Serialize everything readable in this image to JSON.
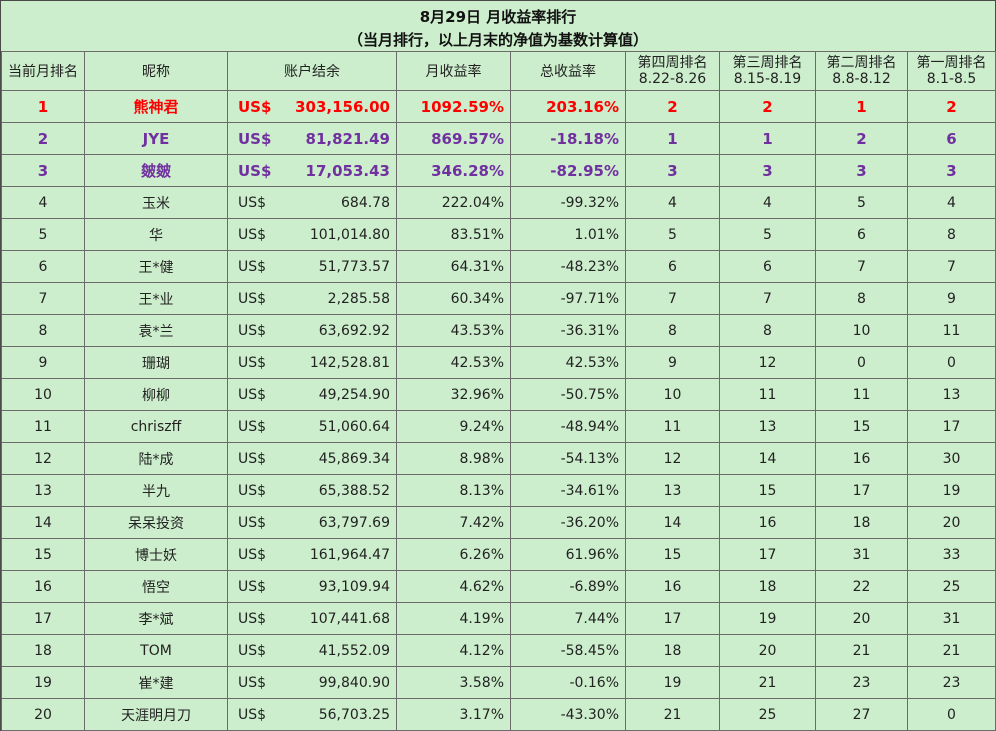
{
  "title": "8月29日 月收益率排行",
  "subtitle": "（当月排行，以上月末的净值为基数计算值）",
  "headers": {
    "rank": "当前月排名",
    "nickname": "昵称",
    "balance": "账户结余",
    "monthly_return": "月收益率",
    "total_return": "总收益率",
    "week4": {
      "label": "第四周排名",
      "range": "8.22-8.26"
    },
    "week3": {
      "label": "第三周排名",
      "range": "8.15-8.19"
    },
    "week2": {
      "label": "第二周排名",
      "range": "8.8-8.12"
    },
    "week1": {
      "label": "第一周排名",
      "range": "8.1-8.5"
    }
  },
  "rows": [
    {
      "rank": "1",
      "name": "熊神君",
      "currency": "US$",
      "balance": "303,156.00",
      "monthly": "1092.59%",
      "total": "203.16%",
      "w4": "2",
      "w3": "2",
      "w2": "1",
      "w1": "2"
    },
    {
      "rank": "2",
      "name": "JYE",
      "currency": "US$",
      "balance": "81,821.49",
      "monthly": "869.57%",
      "total": "-18.18%",
      "w4": "1",
      "w3": "1",
      "w2": "2",
      "w1": "6"
    },
    {
      "rank": "3",
      "name": "皴皴",
      "currency": "US$",
      "balance": "17,053.43",
      "monthly": "346.28%",
      "total": "-82.95%",
      "w4": "3",
      "w3": "3",
      "w2": "3",
      "w1": "3"
    },
    {
      "rank": "4",
      "name": "玉米",
      "currency": "US$",
      "balance": "684.78",
      "monthly": "222.04%",
      "total": "-99.32%",
      "w4": "4",
      "w3": "4",
      "w2": "5",
      "w1": "4"
    },
    {
      "rank": "5",
      "name": "华",
      "currency": "US$",
      "balance": "101,014.80",
      "monthly": "83.51%",
      "total": "1.01%",
      "w4": "5",
      "w3": "5",
      "w2": "6",
      "w1": "8"
    },
    {
      "rank": "6",
      "name": "王*健",
      "currency": "US$",
      "balance": "51,773.57",
      "monthly": "64.31%",
      "total": "-48.23%",
      "w4": "6",
      "w3": "6",
      "w2": "7",
      "w1": "7"
    },
    {
      "rank": "7",
      "name": "王*业",
      "currency": "US$",
      "balance": "2,285.58",
      "monthly": "60.34%",
      "total": "-97.71%",
      "w4": "7",
      "w3": "7",
      "w2": "8",
      "w1": "9"
    },
    {
      "rank": "8",
      "name": "袁*兰",
      "currency": "US$",
      "balance": "63,692.92",
      "monthly": "43.53%",
      "total": "-36.31%",
      "w4": "8",
      "w3": "8",
      "w2": "10",
      "w1": "11"
    },
    {
      "rank": "9",
      "name": "珊瑚",
      "currency": "US$",
      "balance": "142,528.81",
      "monthly": "42.53%",
      "total": "42.53%",
      "w4": "9",
      "w3": "12",
      "w2": "0",
      "w1": "0"
    },
    {
      "rank": "10",
      "name": "柳柳",
      "currency": "US$",
      "balance": "49,254.90",
      "monthly": "32.96%",
      "total": "-50.75%",
      "w4": "10",
      "w3": "11",
      "w2": "11",
      "w1": "13"
    },
    {
      "rank": "11",
      "name": "chriszff",
      "currency": "US$",
      "balance": "51,060.64",
      "monthly": "9.24%",
      "total": "-48.94%",
      "w4": "11",
      "w3": "13",
      "w2": "15",
      "w1": "17"
    },
    {
      "rank": "12",
      "name": "陆*成",
      "currency": "US$",
      "balance": "45,869.34",
      "monthly": "8.98%",
      "total": "-54.13%",
      "w4": "12",
      "w3": "14",
      "w2": "16",
      "w1": "30"
    },
    {
      "rank": "13",
      "name": "半九",
      "currency": "US$",
      "balance": "65,388.52",
      "monthly": "8.13%",
      "total": "-34.61%",
      "w4": "13",
      "w3": "15",
      "w2": "17",
      "w1": "19"
    },
    {
      "rank": "14",
      "name": "呆呆投资",
      "currency": "US$",
      "balance": "63,797.69",
      "monthly": "7.42%",
      "total": "-36.20%",
      "w4": "14",
      "w3": "16",
      "w2": "18",
      "w1": "20"
    },
    {
      "rank": "15",
      "name": "博士妖",
      "currency": "US$",
      "balance": "161,964.47",
      "monthly": "6.26%",
      "total": "61.96%",
      "w4": "15",
      "w3": "17",
      "w2": "31",
      "w1": "33"
    },
    {
      "rank": "16",
      "name": "悟空",
      "currency": "US$",
      "balance": "93,109.94",
      "monthly": "4.62%",
      "total": "-6.89%",
      "w4": "16",
      "w3": "18",
      "w2": "22",
      "w1": "25"
    },
    {
      "rank": "17",
      "name": "李*斌",
      "currency": "US$",
      "balance": "107,441.68",
      "monthly": "4.19%",
      "total": "7.44%",
      "w4": "17",
      "w3": "19",
      "w2": "20",
      "w1": "31"
    },
    {
      "rank": "18",
      "name": "TOM",
      "currency": "US$",
      "balance": "41,552.09",
      "monthly": "4.12%",
      "total": "-58.45%",
      "w4": "18",
      "w3": "20",
      "w2": "21",
      "w1": "21"
    },
    {
      "rank": "19",
      "name": "崔*建",
      "currency": "US$",
      "balance": "99,840.90",
      "monthly": "3.58%",
      "total": "-0.16%",
      "w4": "19",
      "w3": "21",
      "w2": "23",
      "w1": "23"
    },
    {
      "rank": "20",
      "name": "天涯明月刀",
      "currency": "US$",
      "balance": "56,703.25",
      "monthly": "3.17%",
      "total": "-43.30%",
      "w4": "21",
      "w3": "25",
      "w2": "27",
      "w1": "0"
    }
  ]
}
